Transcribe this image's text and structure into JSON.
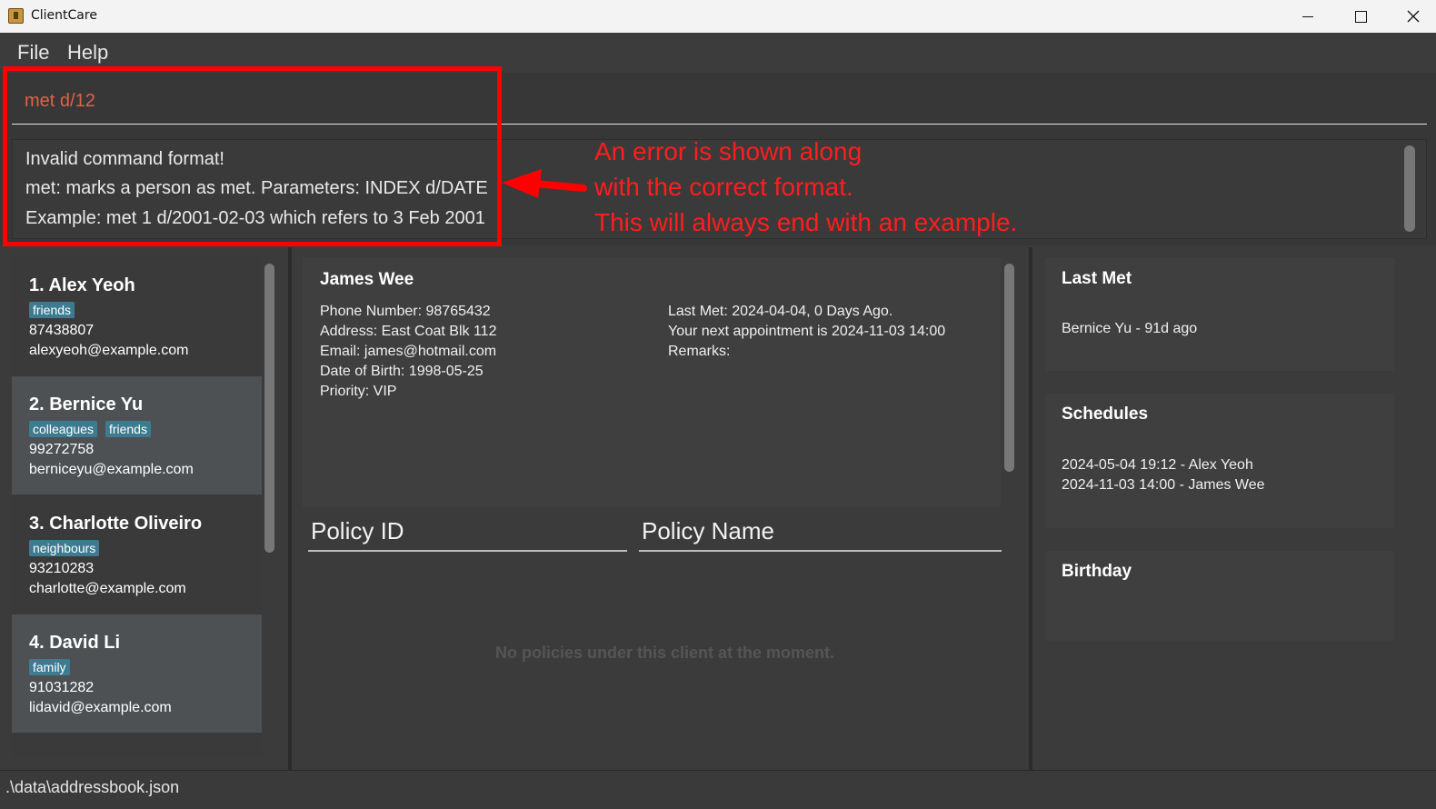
{
  "window": {
    "title": "ClientCare"
  },
  "menu": {
    "file": "File",
    "help": "Help"
  },
  "command": {
    "value": "met d/12"
  },
  "result": {
    "lines": [
      "Invalid command format!",
      "met: marks a person as met. Parameters: INDEX d/DATE",
      "Example: met 1 d/2001-02-03 which refers to 3 Feb 2001"
    ]
  },
  "annotation": {
    "color": "#ff1d1d",
    "lines": [
      "An error is shown along",
      "with the correct format.",
      "This will always end with an example."
    ]
  },
  "persons": [
    {
      "name": "1.  Alex Yeoh",
      "tags": [
        "friends"
      ],
      "phone": "87438807",
      "email": "alexyeoh@example.com"
    },
    {
      "name": "2.  Bernice Yu",
      "tags": [
        "colleagues",
        "friends"
      ],
      "phone": "99272758",
      "email": "berniceyu@example.com"
    },
    {
      "name": "3.  Charlotte Oliveiro",
      "tags": [
        "neighbours"
      ],
      "phone": "93210283",
      "email": "charlotte@example.com"
    },
    {
      "name": "4.  David Li",
      "tags": [
        "family"
      ],
      "phone": "91031282",
      "email": "lidavid@example.com"
    }
  ],
  "detail": {
    "name": "James Wee",
    "phone": "Phone Number: 98765432",
    "address": "Address: East Coat Blk 112",
    "email": "Email: james@hotmail.com",
    "dob": "Date of Birth: 1998-05-25",
    "priority": "Priority: VIP",
    "last_met": "Last Met: 2024-04-04, 0 Days Ago.",
    "appointment": "Your next appointment is 2024-11-03 14:00",
    "remarks": "Remarks:"
  },
  "policies": {
    "col_id": "Policy ID",
    "col_name": "Policy Name",
    "empty": "No policies under this client at the moment."
  },
  "sidebar": {
    "last_met": {
      "title": "Last Met",
      "items": [
        "Bernice Yu - 91d ago"
      ]
    },
    "schedules": {
      "title": "Schedules",
      "items": [
        "2024-05-04 19:12 - Alex Yeoh",
        "2024-11-03 14:00 - James Wee"
      ]
    },
    "birthday": {
      "title": "Birthday"
    }
  },
  "status": {
    "path": ".\\data\\addressbook.json"
  },
  "colors": {
    "tag": "#3e7b91",
    "error_text": "#e06245",
    "background": "#3b3b3b"
  }
}
